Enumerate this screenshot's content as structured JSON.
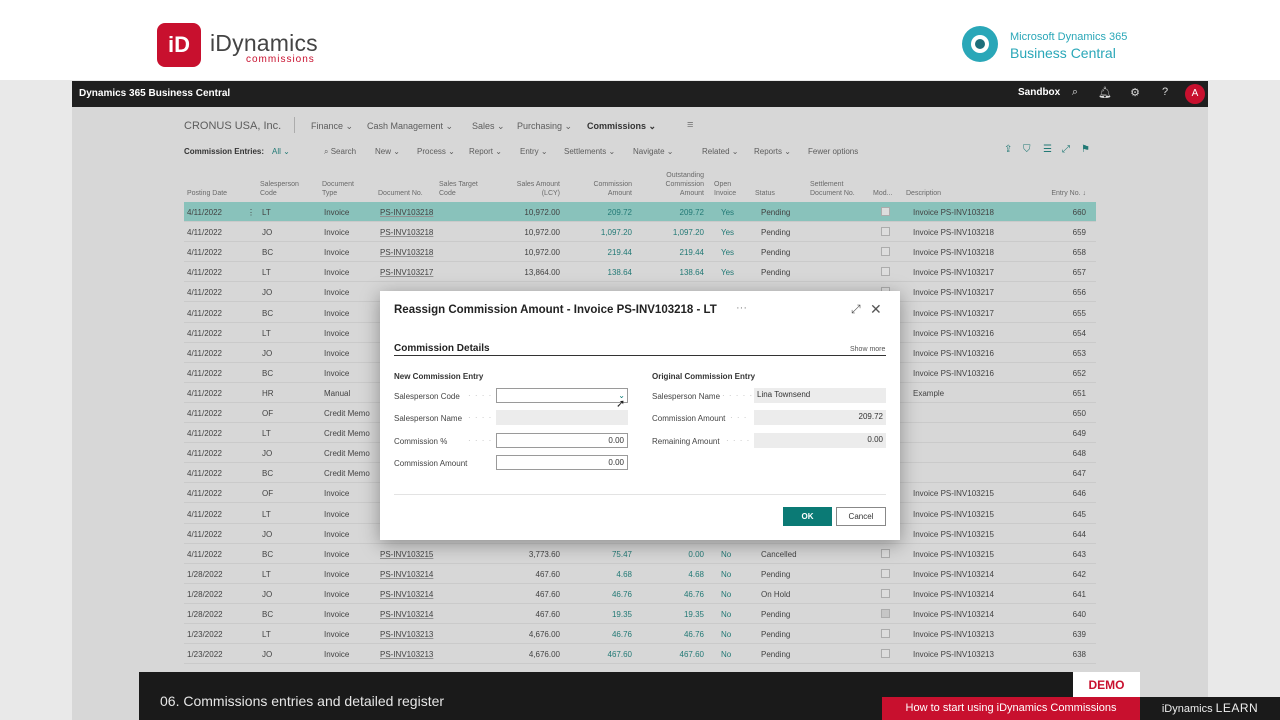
{
  "branding": {
    "logo_letter": "iD",
    "name": "iDynamics",
    "sub": "commissions",
    "ms_line1": "Microsoft Dynamics 365",
    "ms_line2": "Business Central"
  },
  "appbar": {
    "title": "Dynamics 365 Business Central",
    "environment": "Sandbox",
    "avatar_letter": "A"
  },
  "nav": {
    "company": "CRONUS USA, Inc.",
    "items": [
      "Finance",
      "Cash Management",
      "Sales",
      "Purchasing",
      "Commissions"
    ],
    "active": "Commissions"
  },
  "commands": {
    "page_label": "Commission Entries:",
    "filter": "All",
    "items": [
      "Search",
      "New",
      "Process",
      "Report",
      "Entry",
      "Settlements",
      "Navigate",
      "Related",
      "Reports",
      "Fewer options"
    ]
  },
  "grid": {
    "columns": [
      "Posting Date",
      "Salesperson Code",
      "Document Type",
      "Document No.",
      "Sales Target Code",
      "Sales Amount (LCY)",
      "Commission Amount",
      "Outstanding Commission Amount",
      "Open Invoice",
      "Status",
      "Settlement Document No.",
      "Mod...",
      "Description",
      "Entry No. ↓"
    ],
    "rows": [
      {
        "date": "4/11/2022",
        "sp": "LT",
        "type": "Invoice",
        "doc": "PS-INV103218",
        "sales": "10,972.00",
        "comm": "209.72",
        "out": "209.72",
        "open": "Yes",
        "status": "Pending",
        "mod": false,
        "desc": "Invoice PS-INV103218",
        "entry": "660"
      },
      {
        "date": "4/11/2022",
        "sp": "JO",
        "type": "Invoice",
        "doc": "PS-INV103218",
        "sales": "10,972.00",
        "comm": "1,097.20",
        "out": "1,097.20",
        "open": "Yes",
        "status": "Pending",
        "mod": false,
        "desc": "Invoice PS-INV103218",
        "entry": "659"
      },
      {
        "date": "4/11/2022",
        "sp": "BC",
        "type": "Invoice",
        "doc": "PS-INV103218",
        "sales": "10,972.00",
        "comm": "219.44",
        "out": "219.44",
        "open": "Yes",
        "status": "Pending",
        "mod": false,
        "desc": "Invoice PS-INV103218",
        "entry": "658"
      },
      {
        "date": "4/11/2022",
        "sp": "LT",
        "type": "Invoice",
        "doc": "PS-INV103217",
        "sales": "13,864.00",
        "comm": "138.64",
        "out": "138.64",
        "open": "Yes",
        "status": "Pending",
        "mod": false,
        "desc": "Invoice PS-INV103217",
        "entry": "657"
      },
      {
        "date": "4/11/2022",
        "sp": "JO",
        "type": "Invoice",
        "doc": "",
        "sales": "",
        "comm": "",
        "out": "",
        "open": "",
        "status": "",
        "mod": false,
        "desc": "Invoice PS-INV103217",
        "entry": "656"
      },
      {
        "date": "4/11/2022",
        "sp": "BC",
        "type": "Invoice",
        "doc": "",
        "sales": "",
        "comm": "",
        "out": "",
        "open": "",
        "status": "",
        "mod": false,
        "desc": "Invoice PS-INV103217",
        "entry": "655"
      },
      {
        "date": "4/11/2022",
        "sp": "LT",
        "type": "Invoice",
        "doc": "",
        "sales": "",
        "comm": "",
        "out": "",
        "open": "",
        "status": "",
        "mod": false,
        "desc": "Invoice PS-INV103216",
        "entry": "654"
      },
      {
        "date": "4/11/2022",
        "sp": "JO",
        "type": "Invoice",
        "doc": "",
        "sales": "",
        "comm": "",
        "out": "",
        "open": "",
        "status": "",
        "mod": false,
        "desc": "Invoice PS-INV103216",
        "entry": "653"
      },
      {
        "date": "4/11/2022",
        "sp": "BC",
        "type": "Invoice",
        "doc": "",
        "sales": "",
        "comm": "",
        "out": "",
        "open": "",
        "status": "",
        "mod": false,
        "desc": "Invoice PS-INV103216",
        "entry": "652"
      },
      {
        "date": "4/11/2022",
        "sp": "HR",
        "type": "Manual",
        "doc": "",
        "sales": "",
        "comm": "",
        "out": "",
        "open": "",
        "status": "",
        "mod": false,
        "desc": "Example",
        "entry": "651"
      },
      {
        "date": "4/11/2022",
        "sp": "OF",
        "type": "Credit Memo",
        "doc": "",
        "sales": "",
        "comm": "",
        "out": "",
        "open": "",
        "status": "",
        "mod": false,
        "desc": "",
        "entry": "650"
      },
      {
        "date": "4/11/2022",
        "sp": "LT",
        "type": "Credit Memo",
        "doc": "",
        "sales": "",
        "comm": "",
        "out": "",
        "open": "",
        "status": "",
        "mod": false,
        "desc": "",
        "entry": "649"
      },
      {
        "date": "4/11/2022",
        "sp": "JO",
        "type": "Credit Memo",
        "doc": "",
        "sales": "",
        "comm": "",
        "out": "",
        "open": "",
        "status": "",
        "mod": false,
        "desc": "",
        "entry": "648"
      },
      {
        "date": "4/11/2022",
        "sp": "BC",
        "type": "Credit Memo",
        "doc": "",
        "sales": "",
        "comm": "",
        "out": "",
        "open": "",
        "status": "",
        "mod": false,
        "desc": "",
        "entry": "647"
      },
      {
        "date": "4/11/2022",
        "sp": "OF",
        "type": "Invoice",
        "doc": "",
        "sales": "",
        "comm": "",
        "out": "",
        "open": "",
        "status": "",
        "mod": false,
        "desc": "Invoice PS-INV103215",
        "entry": "646"
      },
      {
        "date": "4/11/2022",
        "sp": "LT",
        "type": "Invoice",
        "doc": "",
        "sales": "",
        "comm": "",
        "out": "",
        "open": "",
        "status": "",
        "mod": false,
        "desc": "Invoice PS-INV103215",
        "entry": "645"
      },
      {
        "date": "4/11/2022",
        "sp": "JO",
        "type": "Invoice",
        "doc": "",
        "sales": "",
        "comm": "",
        "out": "",
        "open": "",
        "status": "",
        "mod": false,
        "desc": "Invoice PS-INV103215",
        "entry": "644"
      },
      {
        "date": "4/11/2022",
        "sp": "BC",
        "type": "Invoice",
        "doc": "PS-INV103215",
        "sales": "3,773.60",
        "comm": "75.47",
        "out": "0.00",
        "open": "No",
        "status": "Cancelled",
        "mod": false,
        "desc": "Invoice PS-INV103215",
        "entry": "643"
      },
      {
        "date": "1/28/2022",
        "sp": "LT",
        "type": "Invoice",
        "doc": "PS-INV103214",
        "sales": "467.60",
        "comm": "4.68",
        "out": "4.68",
        "open": "No",
        "status": "Pending",
        "mod": false,
        "desc": "Invoice PS-INV103214",
        "entry": "642"
      },
      {
        "date": "1/28/2022",
        "sp": "JO",
        "type": "Invoice",
        "doc": "PS-INV103214",
        "sales": "467.60",
        "comm": "46.76",
        "out": "46.76",
        "open": "No",
        "status": "On Hold",
        "mod": false,
        "desc": "Invoice PS-INV103214",
        "entry": "641"
      },
      {
        "date": "1/28/2022",
        "sp": "BC",
        "type": "Invoice",
        "doc": "PS-INV103214",
        "sales": "467.60",
        "comm": "19.35",
        "out": "19.35",
        "open": "No",
        "status": "Pending",
        "mod": true,
        "desc": "Invoice PS-INV103214",
        "entry": "640"
      },
      {
        "date": "1/23/2022",
        "sp": "LT",
        "type": "Invoice",
        "doc": "PS-INV103213",
        "sales": "4,676.00",
        "comm": "46.76",
        "out": "46.76",
        "open": "No",
        "status": "Pending",
        "mod": false,
        "desc": "Invoice PS-INV103213",
        "entry": "639"
      },
      {
        "date": "1/23/2022",
        "sp": "JO",
        "type": "Invoice",
        "doc": "PS-INV103213",
        "sales": "4,676.00",
        "comm": "467.60",
        "out": "467.60",
        "open": "No",
        "status": "Pending",
        "mod": false,
        "desc": "Invoice PS-INV103213",
        "entry": "638"
      }
    ]
  },
  "dialog": {
    "title": "Reassign Commission Amount - Invoice PS-INV103218  - LT",
    "section": "Commission Details",
    "show_more": "Show more",
    "new_group": "New Commission Entry",
    "orig_group": "Original Commission Entry",
    "new_fields": [
      {
        "label": "Salesperson Code",
        "value": ""
      },
      {
        "label": "Salesperson Name",
        "value": ""
      },
      {
        "label": "Commission %",
        "value": "0.00"
      },
      {
        "label": "Commission Amount",
        "value": "0.00"
      }
    ],
    "orig_fields": [
      {
        "label": "Salesperson Name",
        "value": "Lina Townsend"
      },
      {
        "label": "Commission Amount",
        "value": "209.72"
      },
      {
        "label": "Remaining Amount",
        "value": "0.00"
      }
    ],
    "ok": "OK",
    "cancel": "Cancel"
  },
  "video": {
    "caption": "06. Commissions entries and detailed register",
    "badge": "DEMO",
    "howto": "How to start using iDynamics Commissions",
    "learn_prefix": "iDynamics",
    "learn_suffix": "LEARN"
  },
  "colors": {
    "accent": "#0b7a75",
    "brand_red": "#c8102e",
    "selected_row": "#8fd8cf"
  }
}
